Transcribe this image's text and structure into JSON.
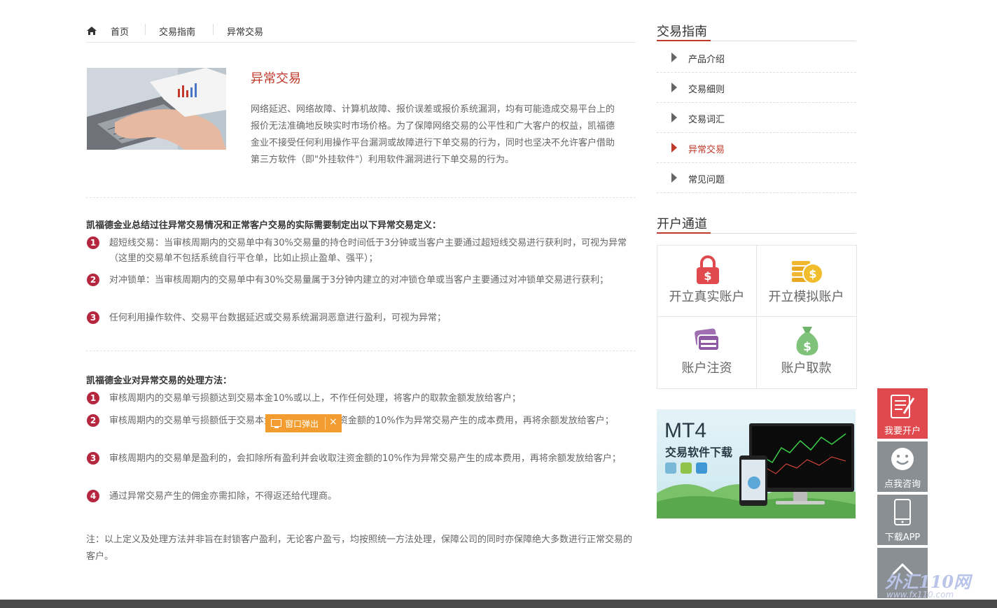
{
  "breadcrumb": {
    "home": "首页",
    "guide": "交易指南",
    "current": "异常交易"
  },
  "intro": {
    "title": "异常交易",
    "text": "网络延迟、网络故障、计算机故障、报价误差或报价系统漏洞，均有可能造成交易平台上的报价无法准确地反映实时市场价格。为了保障网络交易的公平性和广大客户的权益，凯福德金业不接受任何利用操作平台漏洞或故障进行下单交易的行为，同时也坚决不允许客户借助第三方软件（即\"外挂软件\"）利用软件漏洞进行下单交易的行为。"
  },
  "section1": {
    "title": "凯福德金业总结过往异常交易情况和正常客户交易的实际需要制定出以下异常交易定义：",
    "items": [
      {
        "num": "1",
        "text": "超短线交易：当审核周期内的交易单中有30%交易量的持仓时间低于3分钟或当客户主要通过超短线交易进行获利时，可视为异常（这里的交易单不包括系统自行平仓单，比如止损止盈单、强平）；"
      },
      {
        "num": "2",
        "text": "对冲锁单：当审核周期内的交易单中有30%交易量属于3分钟内建立的对冲锁仓单或当客户主要通过对冲锁单交易进行获利；"
      },
      {
        "num": "3",
        "text": "任何利用操作软件、交易平台数据延迟或交易系统漏洞恶意进行盈利，可视为异常；"
      }
    ]
  },
  "section2": {
    "title": "凯福德金业对异常交易的处理方法：",
    "items": [
      {
        "num": "1",
        "text": "审核周期内的交易单亏损额达到交易本金10%或以上，不作任何处理，将客户的取款金额发放给客户；"
      },
      {
        "num": "2",
        "text": "审核周期内的交易单亏损额低于交易本金10%，会收取注资金额的10%作为异常交易产生的成本费用，再将余额发放给客户；"
      },
      {
        "num": "3",
        "text": "审核周期内的交易单是盈利的，会扣除所有盈利并会收取注资金额的10%作为异常交易产生的成本费用，再将余额发放给客户；"
      },
      {
        "num": "4",
        "text": "通过异常交易产生的佣金亦需扣除，不得返还给代理商。"
      }
    ]
  },
  "note": "注：以上定义及处理方法并非旨在封锁客户盈利，无论客户盈亏，均按照统一方法处理，保障公司的同时亦保障绝大多数进行正常交易的客户。",
  "popup": {
    "label": "窗口弹出",
    "close": "×"
  },
  "sidebar": {
    "guide_title": "交易指南",
    "nav": [
      {
        "label": "产品介绍",
        "active": false
      },
      {
        "label": "交易细则",
        "active": false
      },
      {
        "label": "交易词汇",
        "active": false
      },
      {
        "label": "异常交易",
        "active": true
      },
      {
        "label": "常见问题",
        "active": false
      }
    ],
    "account_title": "开户通道",
    "tiles": [
      {
        "label": "开立真实账户",
        "icon": "lock-dollar-icon"
      },
      {
        "label": "开立模拟账户",
        "icon": "coins-icon"
      },
      {
        "label": "账户注资",
        "icon": "card-icon"
      },
      {
        "label": "账户取款",
        "icon": "money-bag-icon"
      }
    ],
    "banner": {
      "title": "MT4",
      "subtitle": "交易软件下载"
    }
  },
  "float": {
    "open": "我要开户",
    "consult": "点我咨询",
    "app": "下载APP"
  },
  "watermark": {
    "main": "外汇110网",
    "url": "www.fx110.com"
  },
  "colors": {
    "accent": "#c0392b",
    "popup": "#f39c2f",
    "float_red": "#e04a4f",
    "float_gray": "#8a8f94"
  }
}
